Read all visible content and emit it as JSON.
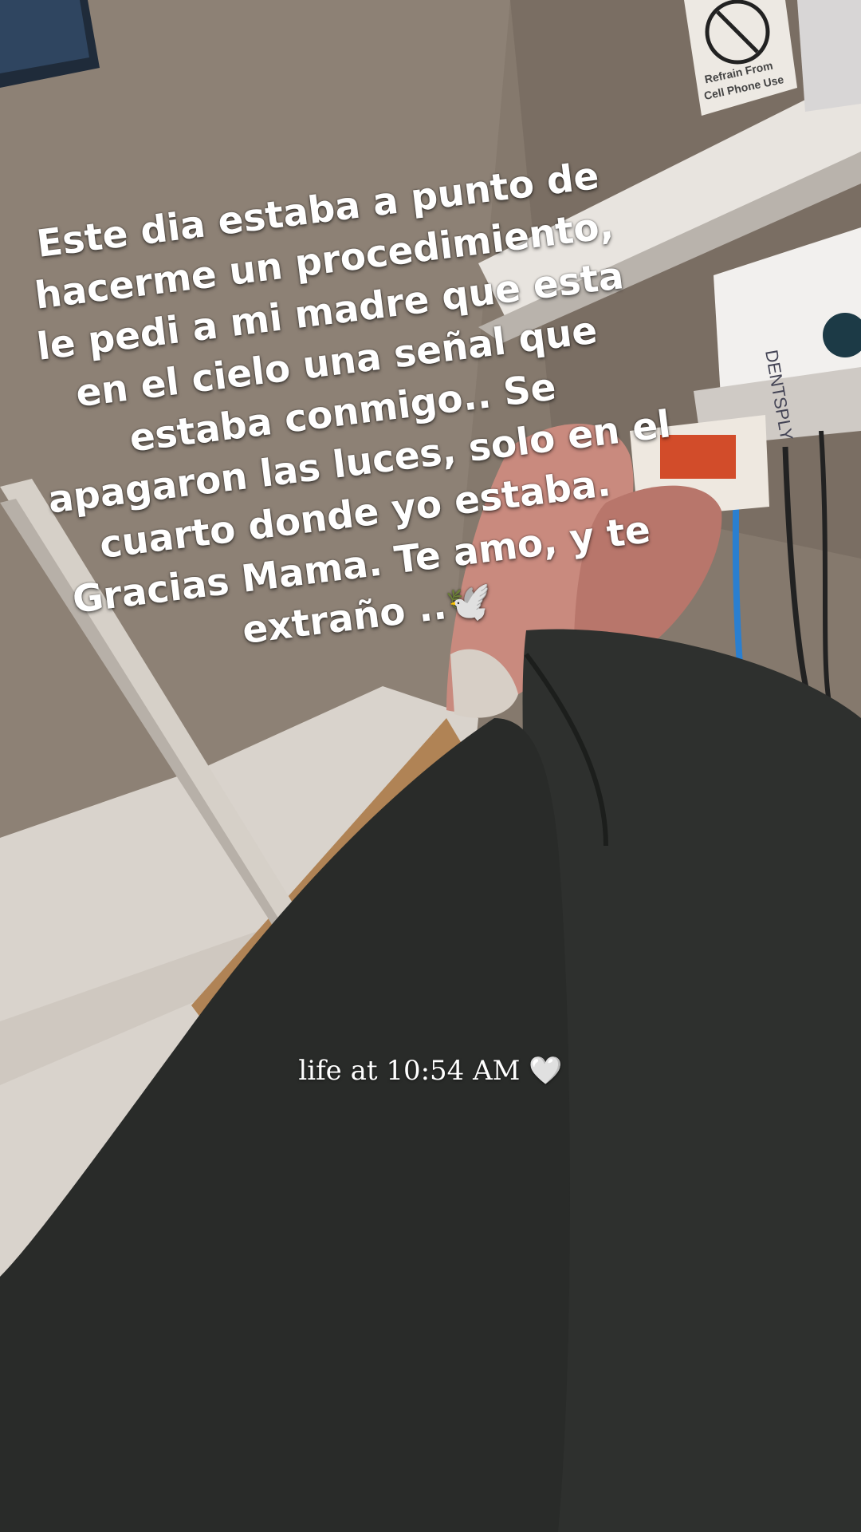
{
  "overlay": {
    "lines": [
      "Este dia estaba a punto de",
      "hacerme un procedimiento,",
      "le pedi a mi madre que esta",
      "en el cielo una señal que",
      "estaba conmigo.. Se",
      "apagaron las luces, solo en el",
      "cuarto donde yo estaba.",
      "Gracias Mama. Te amo, y te",
      "extraño .."
    ],
    "trailing_icon": "dove-icon",
    "emoji": "🕊️"
  },
  "caption": {
    "text": "life at 10:54 AM",
    "icon": "white-heart-icon",
    "emoji": "🤍"
  },
  "sign": {
    "line1": "Refrain From",
    "line2": "Cell Phone Use"
  },
  "device": {
    "brand": "DENTSPLY"
  },
  "colors": {
    "text": "#ffffff",
    "sneaker": "#c98a7e",
    "leggings": "#2c2e2c",
    "wall": "#8a7d70"
  }
}
